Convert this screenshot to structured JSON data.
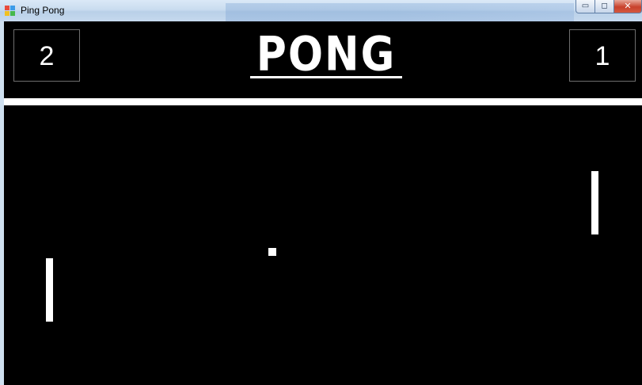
{
  "window": {
    "title": "Ping Pong",
    "minimize_glyph": "▭",
    "maximize_glyph": "◻",
    "close_glyph": "✕"
  },
  "game": {
    "logo_text": "PONG",
    "score_left": "2",
    "score_right": "1",
    "background_color": "#000000",
    "foreground_color": "#ffffff"
  }
}
